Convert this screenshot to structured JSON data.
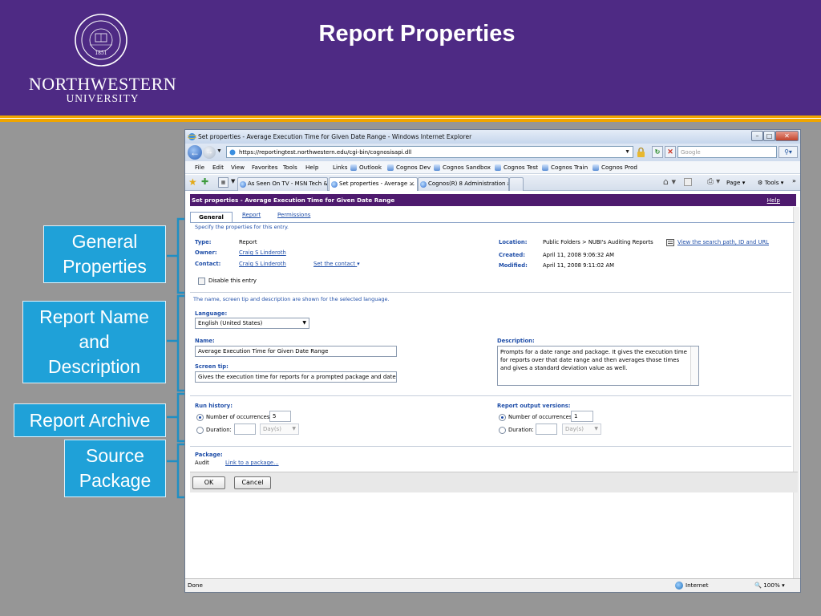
{
  "slide": {
    "title": "Report Properties",
    "org_name": "NORTHWESTERN",
    "org_sub": "UNIVERSITY",
    "seal_year": "1851"
  },
  "callouts": {
    "general": [
      "General",
      "Properties"
    ],
    "name": [
      "Report Name",
      "and",
      "Description"
    ],
    "archive": [
      "Report Archive"
    ],
    "source": [
      "Source",
      "Package"
    ]
  },
  "browser": {
    "window_title": "Set properties - Average Execution Time for Given Date Range - Windows Internet Explorer",
    "url": "https://reportingtest.northwestern.edu/cgi-bin/cognosisapi.dll",
    "search_placeholder": "Google",
    "menu": [
      "File",
      "Edit",
      "View",
      "Favorites",
      "Tools",
      "Help"
    ],
    "links_label": "Links",
    "links": [
      "Outlook",
      "Cognos Dev",
      "Cognos Sandbox",
      "Cognos Test",
      "Cognos Train",
      "Cognos Prod"
    ],
    "tabs": [
      {
        "label": "As Seen On TV - MSN Tech &..."
      },
      {
        "label": "Set properties - Average ..."
      },
      {
        "label": "Cognos(R) 8 Administration a..."
      }
    ],
    "cmd_page": "Page",
    "cmd_tools": "Tools",
    "status": "Done",
    "zone": "Internet",
    "zoom": "100%"
  },
  "page": {
    "header": "Set properties - Average Execution Time for Given Date Range",
    "help": "Help",
    "tabs": [
      "General",
      "Report",
      "Permissions"
    ],
    "specify": "Specify the properties for this entry.",
    "type_label": "Type:",
    "type_value": "Report",
    "owner_label": "Owner:",
    "owner_value": "Craig S Linderoth",
    "contact_label": "Contact:",
    "contact_value": "Craig S Linderoth",
    "set_contact": "Set the contact",
    "location_label": "Location:",
    "location_value": "Public Folders > NUBI's Auditing Reports",
    "search_path_link": "View the search path, ID and URL",
    "created_label": "Created:",
    "created_value": "April 11, 2008 9:06:32 AM",
    "modified_label": "Modified:",
    "modified_value": "April 11, 2008 9:11:02 AM",
    "disable_label": "Disable this entry",
    "lang_note": "The name, screen tip and description are shown for the selected language.",
    "language_label": "Language:",
    "language_value": "English (United States)",
    "name_label": "Name:",
    "name_value": "Average Execution Time for Given Date Range",
    "screentip_label": "Screen tip:",
    "screentip_value": "Gives the execution time for reports for a prompted package and date",
    "description_label": "Description:",
    "description_value": "Prompts for a date range and package.  It gives the execution time for reports over that date range and then averages those times and gives a standard deviation value as well.",
    "run_history_label": "Run history:",
    "run_occ_label": "Number of occurrences:",
    "run_occ_value": "5",
    "run_duration_label": "Duration:",
    "run_days": "Day(s)",
    "output_label": "Report output versions:",
    "out_occ_label": "Number of occurrences:",
    "out_occ_value": "1",
    "out_duration_label": "Duration:",
    "out_days": "Day(s)",
    "package_label": "Package:",
    "package_value": "Audit",
    "package_link": "Link to a package...",
    "ok": "OK",
    "cancel": "Cancel"
  }
}
